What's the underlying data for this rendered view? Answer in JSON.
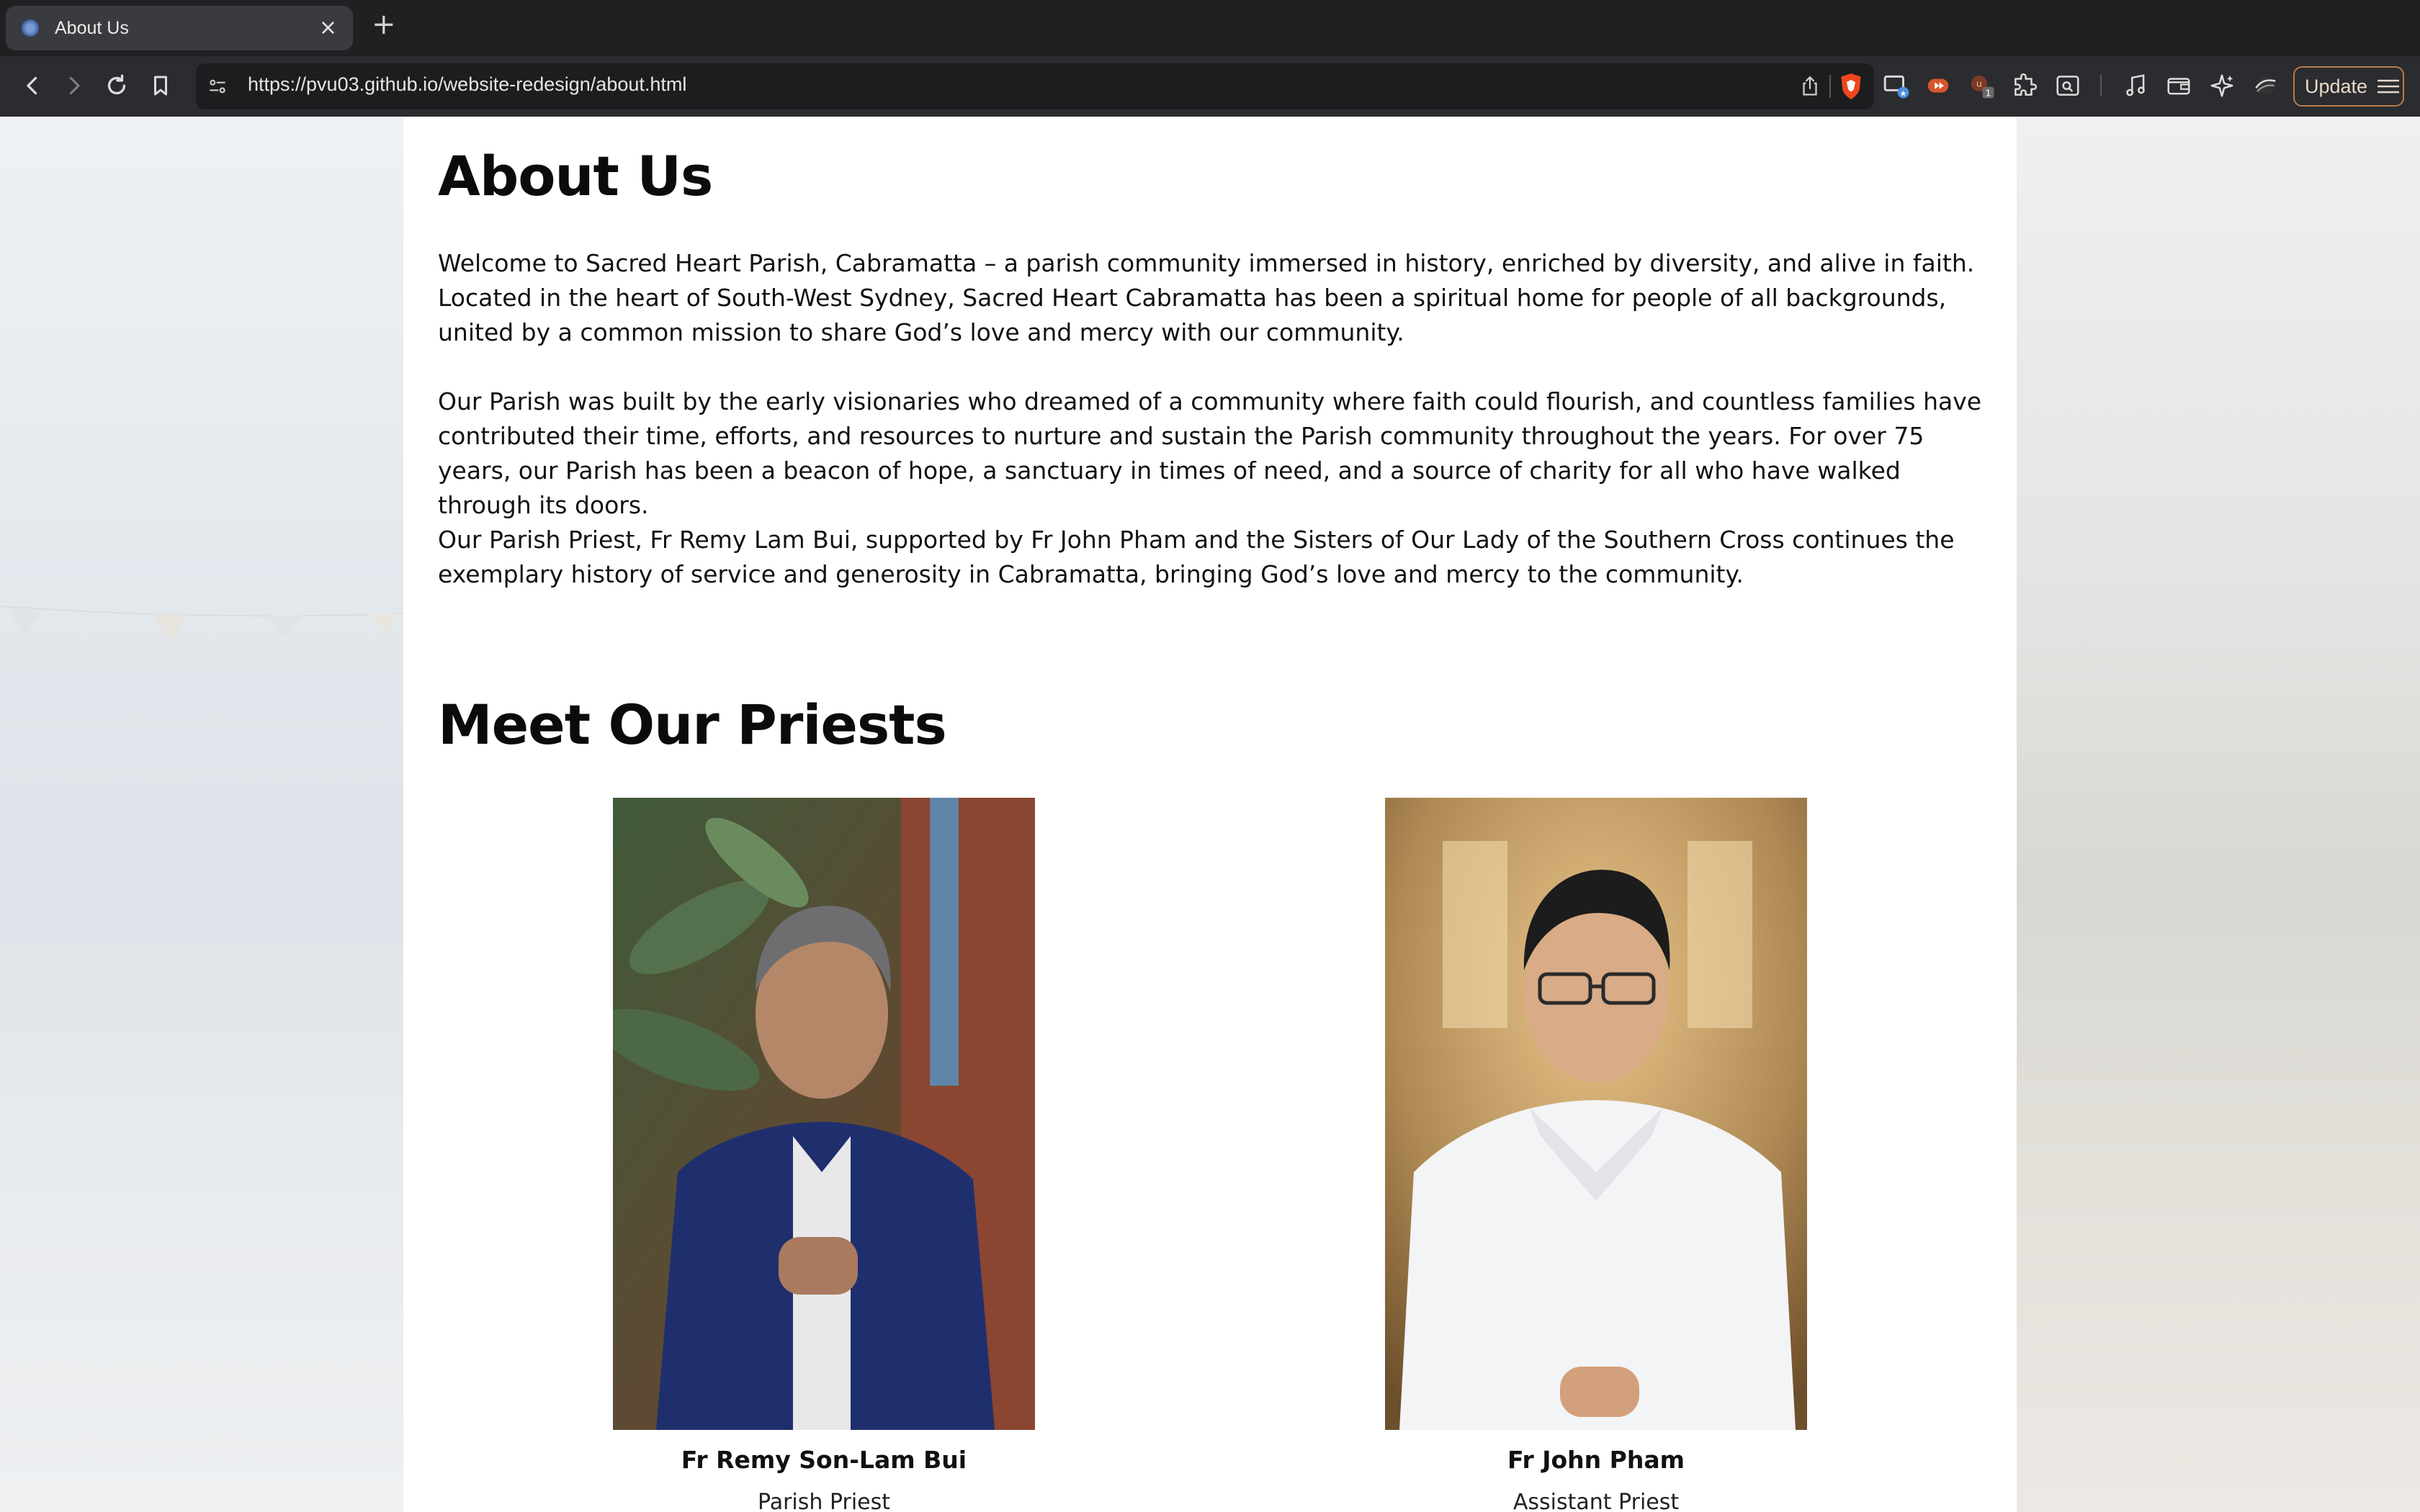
{
  "browser": {
    "tab_title": "About Us",
    "tab_close": "×",
    "new_tab": "+",
    "url": "https://pvu03.github.io/website-redesign/about.html",
    "update_label": "Update",
    "extension_badge": "1"
  },
  "page": {
    "title": "About Us",
    "paragraphs": [
      "Welcome to Sacred Heart Parish, Cabramatta – a parish community immersed in history, enriched by diversity, and alive in faith. Located in the heart of South-West Sydney, Sacred Heart Cabramatta has been a spiritual home for people of all backgrounds, united by a common mission to share God’s love and mercy with our community.",
      "Our Parish was built by the early visionaries who dreamed of a community where faith could flourish, and countless families have contributed their time, efforts, and resources to nurture and sustain the Parish community throughout the years. For over 75 years, our Parish has been a beacon of hope, a sanctuary in times of need, and a source of charity for all who have walked through its doors.",
      "Our Parish Priest, Fr Remy Lam Bui, supported by Fr John Pham and the Sisters of Our Lady of the Southern Cross continues the exemplary history of service and generosity in Cabramatta, bringing God’s love and mercy to the community."
    ],
    "priests_heading": "Meet Our Priests",
    "priests": [
      {
        "name": "Fr Remy Son-Lam Bui",
        "role": "Parish Priest"
      },
      {
        "name": "Fr John Pham",
        "role": "Assistant Priest"
      }
    ]
  },
  "colors": {
    "chrome_bg": "#1f2022",
    "toolbar_bg": "#2b2c2f",
    "update_border": "#b97a4a",
    "brave_orange": "#f0461e"
  },
  "icons": [
    "back-icon",
    "forward-icon",
    "reload-icon",
    "bookmark-icon",
    "site-info-icon",
    "share-icon",
    "brave-shield-icon",
    "extensions-icon",
    "media-icon",
    "wallet-icon",
    "leo-icon",
    "menu-icon"
  ]
}
